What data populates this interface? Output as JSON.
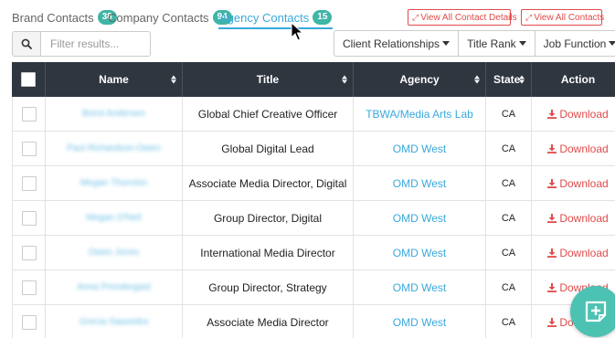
{
  "tabs": [
    {
      "label": "Brand Contacts",
      "count": "38"
    },
    {
      "label": "Company Contacts",
      "count": "94"
    },
    {
      "label": "Agency Contacts",
      "count": "15"
    }
  ],
  "actions": {
    "view_all_details": "View All Contact Details",
    "view_all_contacts": "View All Contacts"
  },
  "search": {
    "placeholder": "Filter results..."
  },
  "filters": {
    "client_relationships": "Client Relationships",
    "title_rank": "Title Rank",
    "job_function": "Job Function"
  },
  "table": {
    "headers": {
      "name": "Name",
      "title": "Title",
      "agency": "Agency",
      "state": "State",
      "action": "Action"
    },
    "rows": [
      {
        "name": "Brent Andersen",
        "title": "Global Chief Creative Officer",
        "agency": "TBWA/Media Arts Lab",
        "state": "CA",
        "action": "Download"
      },
      {
        "name": "Paul Richardson-Owen",
        "title": "Global Digital Lead",
        "agency": "OMD West",
        "state": "CA",
        "action": "Download"
      },
      {
        "name": "Megan Thornton",
        "title": "Associate Media Director, Digital",
        "agency": "OMD West",
        "state": "CA",
        "action": "Download"
      },
      {
        "name": "Megan O'Neil",
        "title": "Group Director, Digital",
        "agency": "OMD West",
        "state": "CA",
        "action": "Download"
      },
      {
        "name": "Owen Jones",
        "title": "International Media Director",
        "agency": "OMD West",
        "state": "CA",
        "action": "Download"
      },
      {
        "name": "Anna Prendergast",
        "title": "Group Director, Strategy",
        "agency": "OMD West",
        "state": "CA",
        "action": "Download"
      },
      {
        "name": "Grecia Saavedra",
        "title": "Associate Media Director",
        "agency": "OMD West",
        "state": "CA",
        "action": "Download"
      }
    ]
  },
  "colors": {
    "accent": "#39a9dc",
    "badge": "#3fb5a5",
    "danger": "#e04b4b",
    "header_bg": "#2f3640",
    "fab": "#4cc2b3"
  },
  "icons": [
    "search-icon",
    "external-link-icon",
    "sort-icon",
    "download-icon",
    "add-note-icon",
    "mouse-cursor-icon"
  ]
}
